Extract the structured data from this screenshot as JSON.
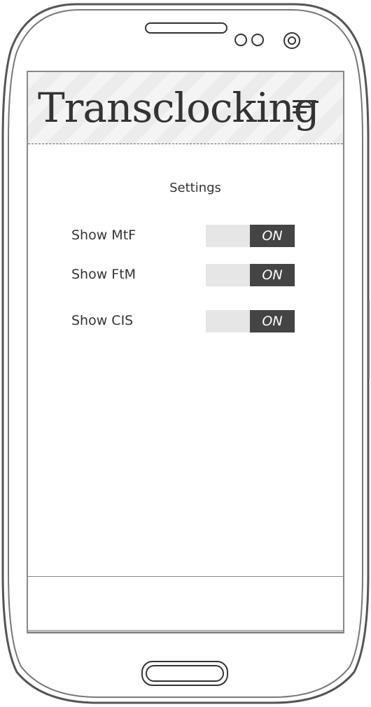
{
  "app": {
    "title": "Transclocking"
  },
  "header": {
    "menu_icon": "hamburger-menu-icon"
  },
  "settings": {
    "title": "Settings",
    "items": [
      {
        "label": "Show MtF",
        "toggle_label": "ON",
        "enabled": true
      },
      {
        "label": "Show FtM",
        "toggle_label": "ON",
        "enabled": true
      },
      {
        "label": "Show CIS",
        "toggle_label": "ON",
        "enabled": true
      }
    ]
  }
}
